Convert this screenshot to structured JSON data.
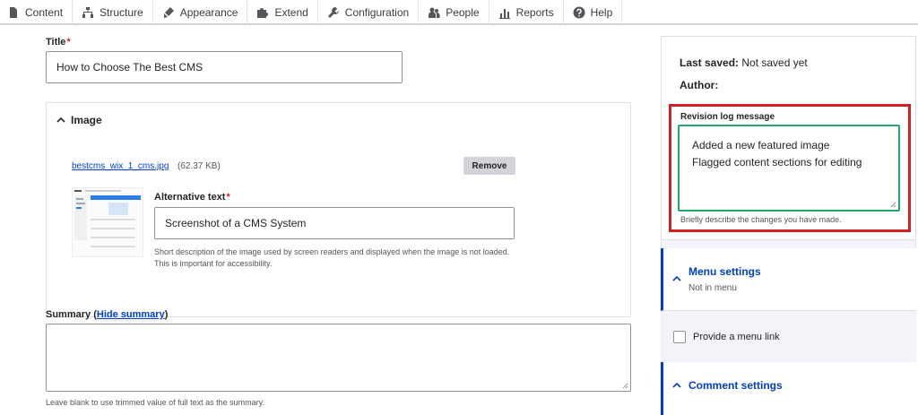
{
  "toolbar": {
    "items": [
      {
        "label": "Content",
        "icon": "file-icon"
      },
      {
        "label": "Structure",
        "icon": "sitemap-icon"
      },
      {
        "label": "Appearance",
        "icon": "brush-icon"
      },
      {
        "label": "Extend",
        "icon": "puzzle-icon"
      },
      {
        "label": "Configuration",
        "icon": "wrench-icon"
      },
      {
        "label": "People",
        "icon": "people-icon"
      },
      {
        "label": "Reports",
        "icon": "bar-chart-icon"
      },
      {
        "label": "Help",
        "icon": "help-icon"
      }
    ]
  },
  "form": {
    "title_label": "Title",
    "required_mark": "*",
    "title_value": "How to Choose The Best CMS",
    "image": {
      "section_label": "Image",
      "file_name": "bestcms_wix_1_cms.jpg",
      "file_size": "(62.37 KB)",
      "remove_label": "Remove",
      "alt_label": "Alternative text",
      "alt_value": "Screenshot of a CMS System",
      "alt_description": "Short description of the image used by screen readers and displayed when the image is not loaded. This is important for accessibility."
    },
    "summary": {
      "label": "Summary",
      "open_paren": " (",
      "toggle_link": "Hide summary",
      "close_paren": ")",
      "value": "",
      "description": "Leave blank to use trimmed value of full text as the summary."
    }
  },
  "sidebar": {
    "last_saved_label": "Last saved:",
    "last_saved_value": "Not saved yet",
    "author_label": "Author:",
    "revision": {
      "label": "Revision log message",
      "value": "Added a new featured image\nFlagged content sections for editing",
      "description": "Briefly describe the changes you have made."
    },
    "menu_settings": {
      "title": "Menu settings",
      "subtitle": "Not in menu",
      "checkbox_label": "Provide a menu link"
    },
    "comment_settings": {
      "title": "Comment settings"
    }
  },
  "colors": {
    "accent": "#003ecc",
    "highlight": "#d11f26",
    "focus": "#26a769",
    "required": "#dc2323"
  }
}
